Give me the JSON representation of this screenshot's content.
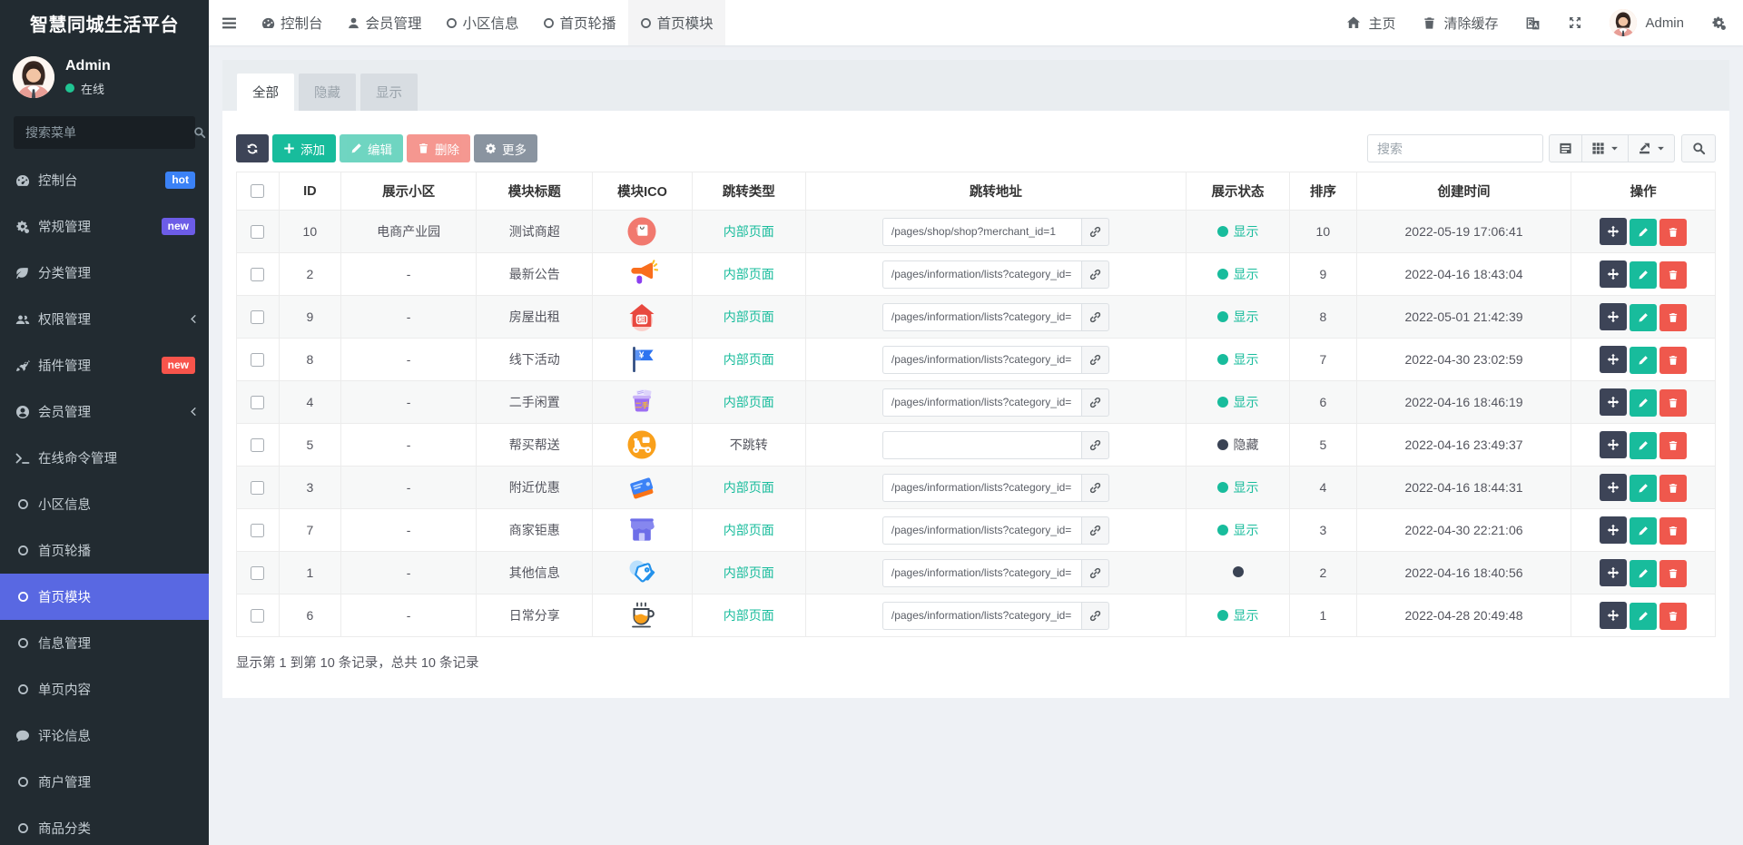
{
  "brand": {
    "title": "智慧同城生活平台"
  },
  "sidebar": {
    "user": {
      "name": "Admin",
      "status_label": "在线",
      "status_color": "#20c593"
    },
    "search_placeholder": "搜索菜单",
    "items": [
      {
        "label": "控制台",
        "icon": "dashboard-icon",
        "badge": {
          "text": "hot",
          "color": "#3b82f6"
        }
      },
      {
        "label": "常规管理",
        "icon": "cogs-icon",
        "badge": {
          "text": "new",
          "color": "#6c5ce7"
        }
      },
      {
        "label": "分类管理",
        "icon": "leaf-icon"
      },
      {
        "label": "权限管理",
        "icon": "users-icon",
        "chevron": true
      },
      {
        "label": "插件管理",
        "icon": "rocket-icon",
        "badge": {
          "text": "new",
          "color": "#f8544b"
        }
      },
      {
        "label": "会员管理",
        "icon": "user-circle-icon",
        "chevron": true
      },
      {
        "label": "在线命令管理",
        "icon": "terminal-icon"
      },
      {
        "label": "小区信息",
        "icon": "circle-icon"
      },
      {
        "label": "首页轮播",
        "icon": "circle-icon"
      },
      {
        "label": "首页模块",
        "icon": "circle-icon",
        "active": true
      },
      {
        "label": "信息管理",
        "icon": "circle-icon"
      },
      {
        "label": "单页内容",
        "icon": "circle-icon"
      },
      {
        "label": "评论信息",
        "icon": "comment-icon"
      },
      {
        "label": "商户管理",
        "icon": "circle-icon"
      },
      {
        "label": "商品分类",
        "icon": "circle-icon"
      }
    ],
    "active_bg": "#5968e2"
  },
  "topbar": {
    "tabs": [
      {
        "label": "控制台",
        "icon": "dashboard-icon"
      },
      {
        "label": "会员管理",
        "icon": "user-icon"
      },
      {
        "label": "小区信息",
        "icon": "circle-icon"
      },
      {
        "label": "首页轮播",
        "icon": "circle-icon"
      },
      {
        "label": "首页模块",
        "icon": "circle-icon",
        "active": true
      }
    ],
    "home_label": "主页",
    "clear_cache_label": "清除缓存",
    "user_name": "Admin"
  },
  "panel": {
    "tabs": [
      {
        "label": "全部",
        "active": true
      },
      {
        "label": "隐藏"
      },
      {
        "label": "显示"
      }
    ],
    "toolbar": {
      "add_label": "添加",
      "edit_label": "编辑",
      "delete_label": "删除",
      "more_label": "更多",
      "search_placeholder": "搜索"
    },
    "table": {
      "columns": [
        "ID",
        "展示小区",
        "模块标题",
        "模块ICO",
        "跳转类型",
        "跳转地址",
        "展示状态",
        "排序",
        "创建时间",
        "操作"
      ],
      "rows": [
        {
          "id": "10",
          "community": "电商产业园",
          "title": "测试商超",
          "icon": "shop-bag-icon",
          "jump_type": "内部页面",
          "jump_internal": true,
          "url": "/pages/shop/shop?merchant_id=1",
          "status": "显示",
          "status_kind": "show",
          "sort": "10",
          "created": "2022-05-19 17:06:41"
        },
        {
          "id": "2",
          "community": "-",
          "title": "最新公告",
          "icon": "megaphone-icon",
          "jump_type": "内部页面",
          "jump_internal": true,
          "url": "/pages/information/lists?category_id=",
          "status": "显示",
          "status_kind": "show",
          "sort": "9",
          "created": "2022-04-16 18:43:04"
        },
        {
          "id": "9",
          "community": "-",
          "title": "房屋出租",
          "icon": "house-rent-icon",
          "jump_type": "内部页面",
          "jump_internal": true,
          "url": "/pages/information/lists?category_id=",
          "status": "显示",
          "status_kind": "show",
          "sort": "8",
          "created": "2022-05-01 21:42:39"
        },
        {
          "id": "8",
          "community": "-",
          "title": "线下活动",
          "icon": "flag-icon",
          "jump_type": "内部页面",
          "jump_internal": true,
          "url": "/pages/information/lists?category_id=",
          "status": "显示",
          "status_kind": "show",
          "sort": "7",
          "created": "2022-04-30 23:02:59"
        },
        {
          "id": "4",
          "community": "-",
          "title": "二手闲置",
          "icon": "basket-icon",
          "jump_type": "内部页面",
          "jump_internal": true,
          "url": "/pages/information/lists?category_id=",
          "status": "显示",
          "status_kind": "show",
          "sort": "6",
          "created": "2022-04-16 18:46:19"
        },
        {
          "id": "5",
          "community": "-",
          "title": "帮买帮送",
          "icon": "scooter-icon",
          "jump_type": "不跳转",
          "jump_internal": false,
          "url": "",
          "status": "隐藏",
          "status_kind": "hide",
          "sort": "5",
          "created": "2022-04-16 23:49:37"
        },
        {
          "id": "3",
          "community": "-",
          "title": "附近优惠",
          "icon": "tickets-icon",
          "jump_type": "内部页面",
          "jump_internal": true,
          "url": "/pages/information/lists?category_id=",
          "status": "显示",
          "status_kind": "show",
          "sort": "4",
          "created": "2022-04-16 18:44:31"
        },
        {
          "id": "7",
          "community": "-",
          "title": "商家钜惠",
          "icon": "store-icon",
          "jump_type": "内部页面",
          "jump_internal": true,
          "url": "/pages/information/lists?category_id=",
          "status": "显示",
          "status_kind": "show",
          "sort": "3",
          "created": "2022-04-30 22:21:06"
        },
        {
          "id": "1",
          "community": "-",
          "title": "其他信息",
          "icon": "price-tag-icon",
          "jump_type": "内部页面",
          "jump_internal": true,
          "url": "/pages/information/lists?category_id=",
          "status": "",
          "status_kind": "dot-only",
          "sort": "2",
          "created": "2022-04-16 18:40:56"
        },
        {
          "id": "6",
          "community": "-",
          "title": "日常分享",
          "icon": "coffee-icon",
          "jump_type": "内部页面",
          "jump_internal": true,
          "url": "/pages/information/lists?category_id=",
          "status": "显示",
          "status_kind": "show",
          "sort": "1",
          "created": "2022-04-28 20:49:48"
        }
      ]
    },
    "footer_text": "显示第 1 到第 10 条记录，总共 10 条记录"
  },
  "colors": {
    "teal": "#18bc9c",
    "dark_button": "#3d4457",
    "danger_button": "#ef584d",
    "gray_button": "#8a94a0",
    "hide_dot": "#3a4354",
    "sidebar_bg": "#222b31",
    "active_menu": "#5968e2"
  }
}
